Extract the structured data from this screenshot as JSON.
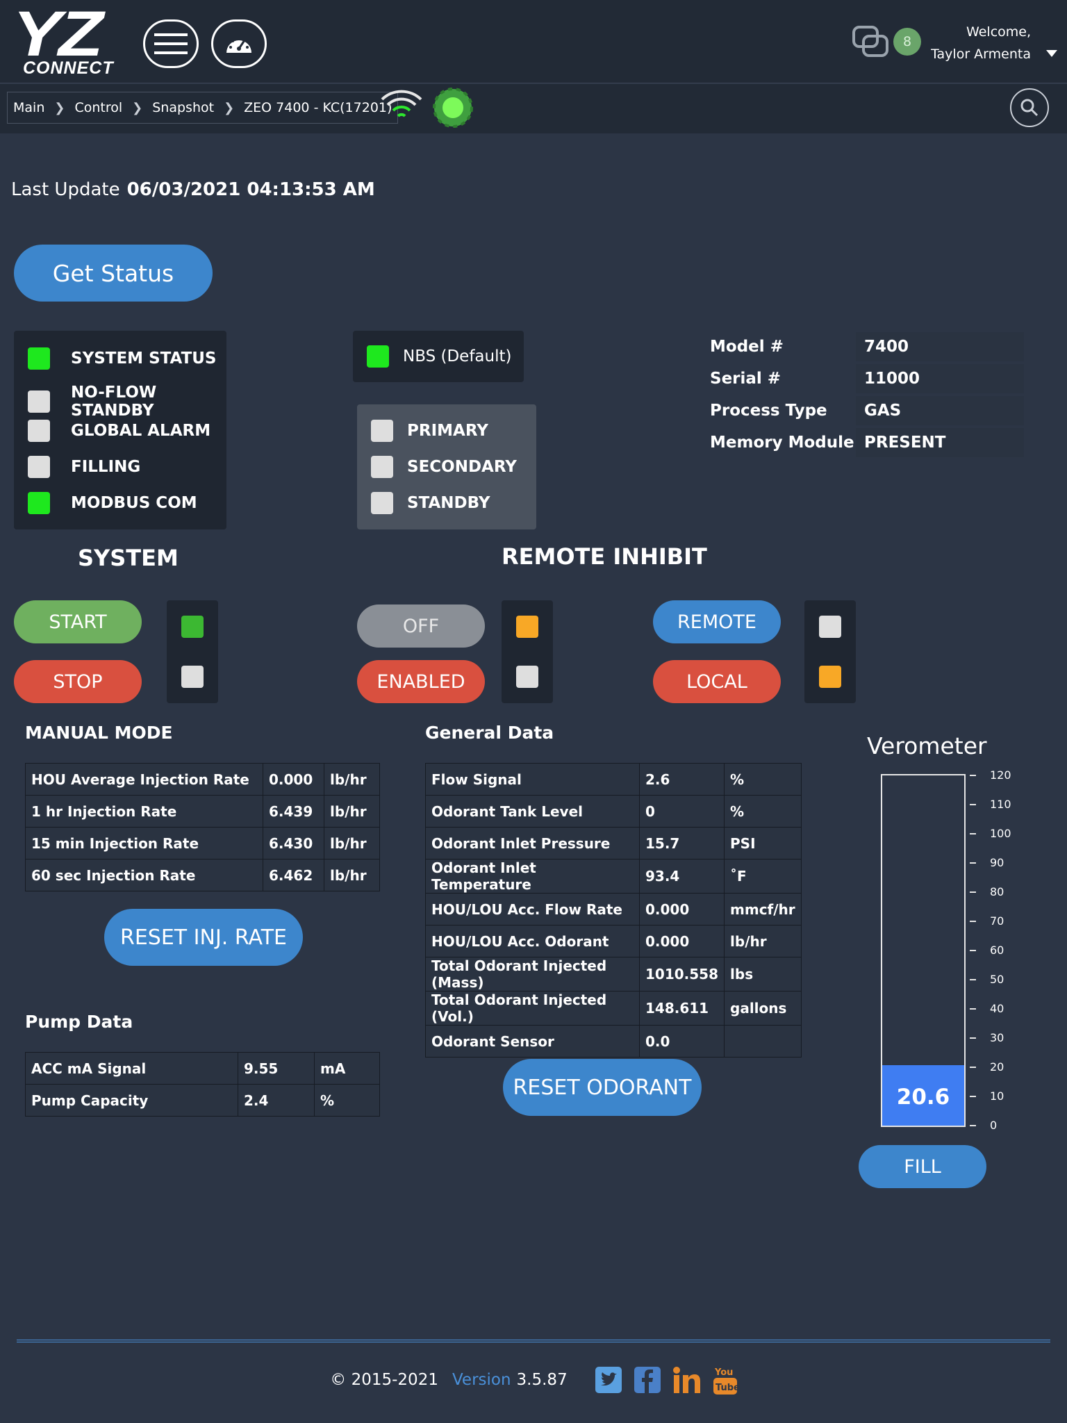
{
  "header": {
    "logo_main": "YZ",
    "logo_sub": "CONNECT",
    "message_count": "8",
    "welcome_line1": "Welcome,",
    "welcome_line2": "Taylor Armenta"
  },
  "breadcrumb": [
    "Main",
    "Control",
    "Snapshot",
    "ZEO 7400 - KC(17201)"
  ],
  "last_update": {
    "label": "Last Update",
    "value": "06/03/2021 04:13:53 AM"
  },
  "get_status_label": "Get Status",
  "status": [
    {
      "label": "SYSTEM STATUS",
      "state": "on"
    },
    {
      "label": "NO-FLOW STANDBY",
      "state": "off"
    },
    {
      "label": "GLOBAL ALARM",
      "state": "off"
    },
    {
      "label": "FILLING",
      "state": "off"
    },
    {
      "label": "MODBUS COM",
      "state": "on"
    }
  ],
  "nbs": {
    "label": "NBS (Default)",
    "state": "on"
  },
  "modes": [
    {
      "label": "PRIMARY",
      "state": "off"
    },
    {
      "label": "SECONDARY",
      "state": "off"
    },
    {
      "label": "STANDBY",
      "state": "off"
    }
  ],
  "info": [
    {
      "key": "Model #",
      "value": "7400"
    },
    {
      "key": "Serial #",
      "value": "11000"
    },
    {
      "key": "Process Type",
      "value": "GAS"
    },
    {
      "key": "Memory Module",
      "value": "PRESENT"
    }
  ],
  "system": {
    "title": "SYSTEM",
    "start": "START",
    "stop": "STOP"
  },
  "remote_inhibit": {
    "title": "REMOTE INHIBIT",
    "off": "OFF",
    "enabled": "ENABLED",
    "remote": "REMOTE",
    "local": "LOCAL"
  },
  "manual_mode": {
    "title": "MANUAL MODE",
    "rows": [
      [
        "HOU Average Injection Rate",
        "0.000",
        "lb/hr"
      ],
      [
        "1 hr Injection Rate",
        "6.439",
        "lb/hr"
      ],
      [
        "15 min Injection Rate",
        "6.430",
        "lb/hr"
      ],
      [
        "60 sec Injection Rate",
        "6.462",
        "lb/hr"
      ]
    ],
    "reset_label": "RESET INJ. RATE"
  },
  "pump_data": {
    "title": "Pump Data",
    "rows": [
      [
        "ACC mA Signal",
        "9.55",
        "mA"
      ],
      [
        "Pump Capacity",
        "2.4",
        "%"
      ]
    ]
  },
  "general_data": {
    "title": "General Data",
    "rows": [
      [
        "Flow Signal",
        "2.6",
        "%"
      ],
      [
        "Odorant Tank Level",
        "0",
        "%"
      ],
      [
        "Odorant Inlet Pressure",
        "15.7",
        "PSI"
      ],
      [
        "Odorant Inlet Temperature",
        "93.4",
        "˚F"
      ],
      [
        "HOU/LOU Acc. Flow Rate",
        "0.000",
        "mmcf/hr"
      ],
      [
        "HOU/LOU Acc. Odorant",
        "0.000",
        "lb/hr"
      ],
      [
        "Total Odorant Injected (Mass)",
        "1010.558",
        "lbs"
      ],
      [
        "Total Odorant Injected (Vol.)",
        "148.611",
        "gallons"
      ],
      [
        "Odorant Sensor",
        "0.0",
        ""
      ]
    ],
    "reset_label": "RESET ODORANT"
  },
  "verometer": {
    "title": "Verometer",
    "value": 20.6,
    "value_text": "20.6",
    "max": 120,
    "ticks": [
      "120",
      "110",
      "100",
      "90",
      "80",
      "70",
      "60",
      "50",
      "40",
      "30",
      "20",
      "10",
      "0"
    ],
    "fill_label": "FILL"
  },
  "footer": {
    "copyright": "© 2015-2021",
    "version_label": "Version",
    "version": "3.5.87"
  },
  "colors": {
    "accent": "#3d86cc",
    "on": "#1ee81e",
    "amber": "#f8a826",
    "start": "#6fb05f",
    "stop": "#d9503f"
  }
}
